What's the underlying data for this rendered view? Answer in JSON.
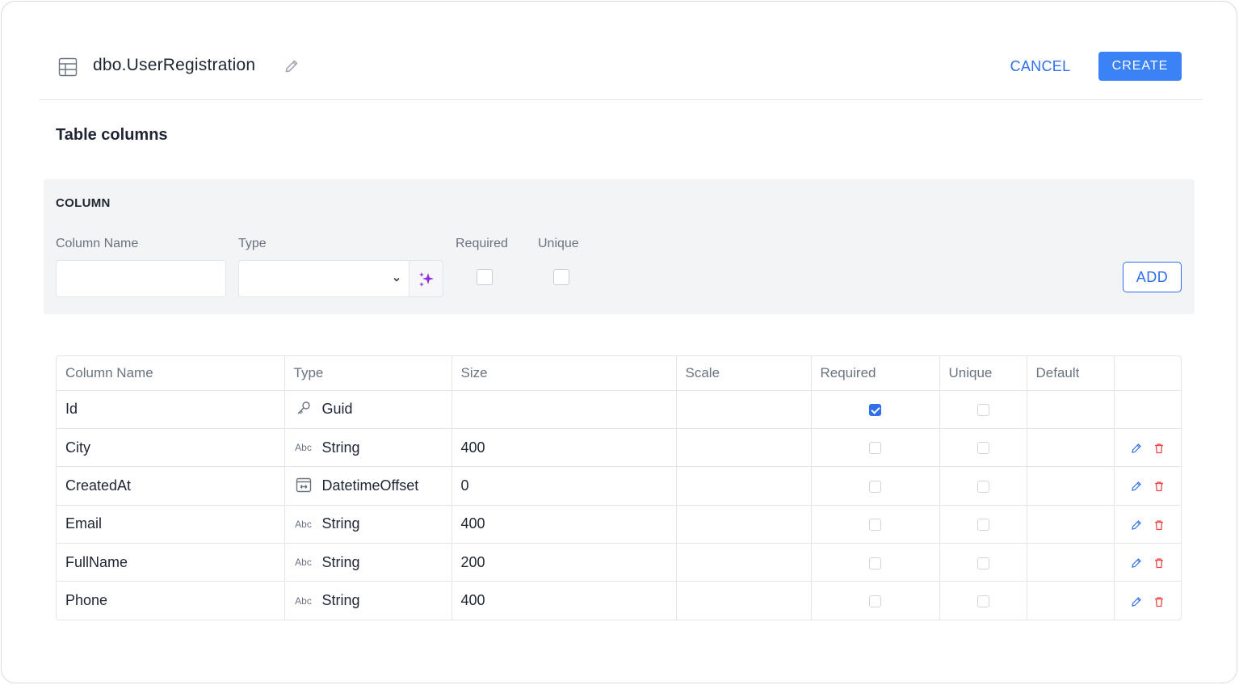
{
  "header": {
    "title": "dbo.UserRegistration",
    "cancel_label": "CANCEL",
    "create_label": "CREATE"
  },
  "section_title": "Table columns",
  "column_form": {
    "heading": "COLUMN",
    "labels": {
      "column_name": "Column Name",
      "type": "Type",
      "required": "Required",
      "unique": "Unique"
    },
    "column_name_value": "",
    "type_value": "",
    "required_checked": false,
    "unique_checked": false,
    "add_label": "ADD"
  },
  "table": {
    "headers": [
      "Column Name",
      "Type",
      "Size",
      "Scale",
      "Required",
      "Unique",
      "Default",
      ""
    ],
    "rows": [
      {
        "name": "Id",
        "type": "Guid",
        "type_icon": "key-icon",
        "size": "",
        "scale": "",
        "required": true,
        "unique": false,
        "default": "",
        "actions": false
      },
      {
        "name": "City",
        "type": "String",
        "type_icon": "abc-icon",
        "size": "400",
        "scale": "",
        "required": false,
        "unique": false,
        "default": "",
        "actions": true
      },
      {
        "name": "CreatedAt",
        "type": "DatetimeOffset",
        "type_icon": "datetime-icon",
        "size": "0",
        "scale": "",
        "required": false,
        "unique": false,
        "default": "",
        "actions": true
      },
      {
        "name": "Email",
        "type": "String",
        "type_icon": "abc-icon",
        "size": "400",
        "scale": "",
        "required": false,
        "unique": false,
        "default": "",
        "actions": true
      },
      {
        "name": "FullName",
        "type": "String",
        "type_icon": "abc-icon",
        "size": "200",
        "scale": "",
        "required": false,
        "unique": false,
        "default": "",
        "actions": true
      },
      {
        "name": "Phone",
        "type": "String",
        "type_icon": "abc-icon",
        "size": "400",
        "scale": "",
        "required": false,
        "unique": false,
        "default": "",
        "actions": true
      }
    ],
    "abc_icon_text": "Abc"
  },
  "colors": {
    "accent": "#3b82f6",
    "link": "#2f6fea",
    "delete": "#ef4444",
    "magic": "#8b2be2",
    "panel_bg": "#f3f4f6"
  }
}
